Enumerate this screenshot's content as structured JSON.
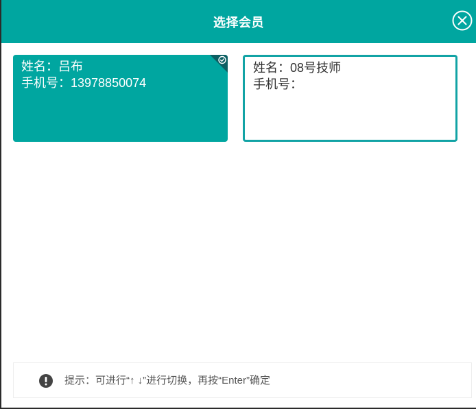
{
  "dialog": {
    "title": "选择会员"
  },
  "members": [
    {
      "name_line": "姓名：吕布",
      "phone_line": "手机号：13978850074",
      "selected": true
    },
    {
      "name_line": "姓名：08号技师",
      "phone_line": "手机号：",
      "selected": false
    }
  ],
  "hint": {
    "text": "提示：可进行“↑ ↓”进行切换，再按“Enter”确定"
  },
  "icons": {
    "close": "close-circle-icon",
    "selected_check": "check-circle-icon",
    "hint": "exclamation-circle-icon"
  },
  "colors": {
    "accent": "#00a6a0",
    "card_border": "#12a3a5",
    "corner_dark": "#0d5f63",
    "text_dark": "#333333",
    "hint_text": "#555555"
  }
}
